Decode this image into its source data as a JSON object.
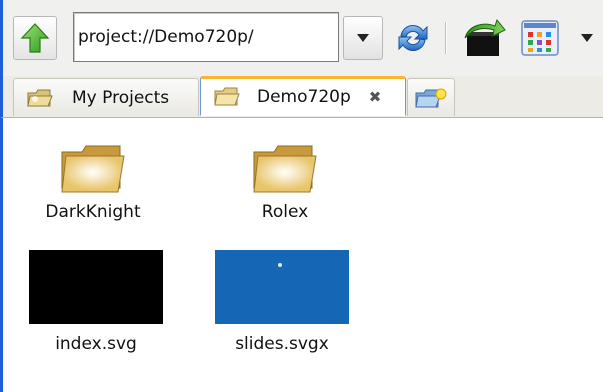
{
  "toolbar": {
    "path_value": "project://Demo720p/",
    "icons": {
      "up": "green-up-arrow-icon",
      "dropdown": "chevron-down-icon",
      "refresh": "refresh-icon",
      "export": "export-icon",
      "view": "view-grid-icon",
      "menu": "menu-down-icon"
    }
  },
  "tabs": [
    {
      "label": "My Projects",
      "icon": "projects-folder-icon",
      "active": false
    },
    {
      "label": "Demo720p",
      "icon": "folder-icon",
      "active": true,
      "closable": true
    },
    {
      "label": "",
      "icon": "new-tab-folder-icon",
      "active": false
    }
  ],
  "items": [
    {
      "label": "DarkKnight",
      "type": "folder"
    },
    {
      "label": "Rolex",
      "type": "folder"
    },
    {
      "label": "index.svg",
      "type": "file"
    },
    {
      "label": "slides.svgx",
      "type": "file"
    }
  ],
  "colors": {
    "accent_border": "#1d5fd6",
    "active_tab_top": "#f7b531",
    "slides_thumb": "#1566b4",
    "index_thumb": "#000000"
  }
}
